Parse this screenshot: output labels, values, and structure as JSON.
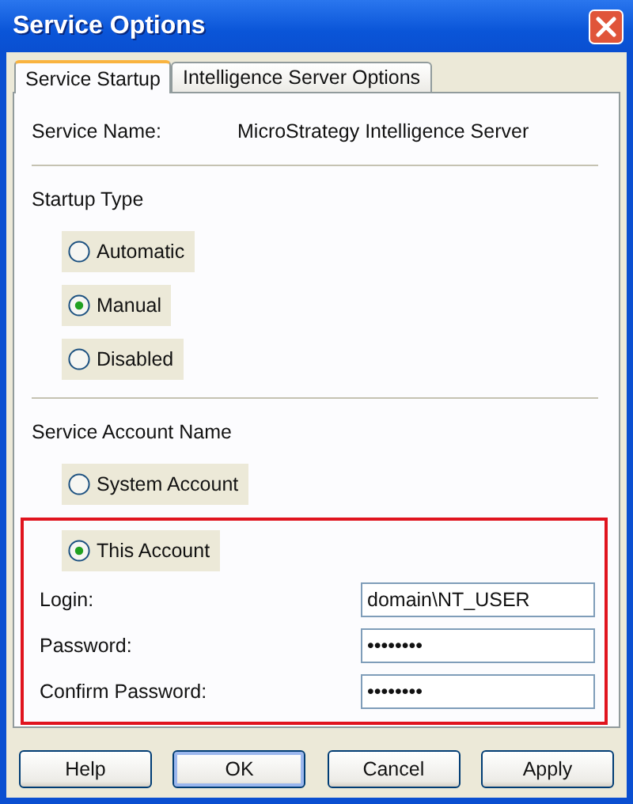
{
  "window": {
    "title": "Service Options"
  },
  "tabs": [
    {
      "label": "Service Startup",
      "selected": true
    },
    {
      "label": "Intelligence Server Options",
      "selected": false
    }
  ],
  "service_name": {
    "label": "Service Name:",
    "value": "MicroStrategy Intelligence Server"
  },
  "startup_type": {
    "title": "Startup Type",
    "options": [
      {
        "label": "Automatic",
        "selected": false
      },
      {
        "label": "Manual",
        "selected": true
      },
      {
        "label": "Disabled",
        "selected": false
      }
    ]
  },
  "service_account": {
    "title": "Service Account Name",
    "options": [
      {
        "label": "System Account",
        "selected": false
      }
    ],
    "highlighted_group": {
      "options": [
        {
          "label": "This Account",
          "selected": true
        }
      ],
      "fields": [
        {
          "label": "Login:",
          "value": "domain\\NT_USER"
        },
        {
          "label": "Password:",
          "value": "••••••••"
        },
        {
          "label": "Confirm Password:",
          "value": "••••••••"
        }
      ]
    }
  },
  "buttons": [
    {
      "label": "Help",
      "default": false
    },
    {
      "label": "OK",
      "default": true
    },
    {
      "label": "Cancel",
      "default": false
    },
    {
      "label": "Apply",
      "default": false
    }
  ]
}
